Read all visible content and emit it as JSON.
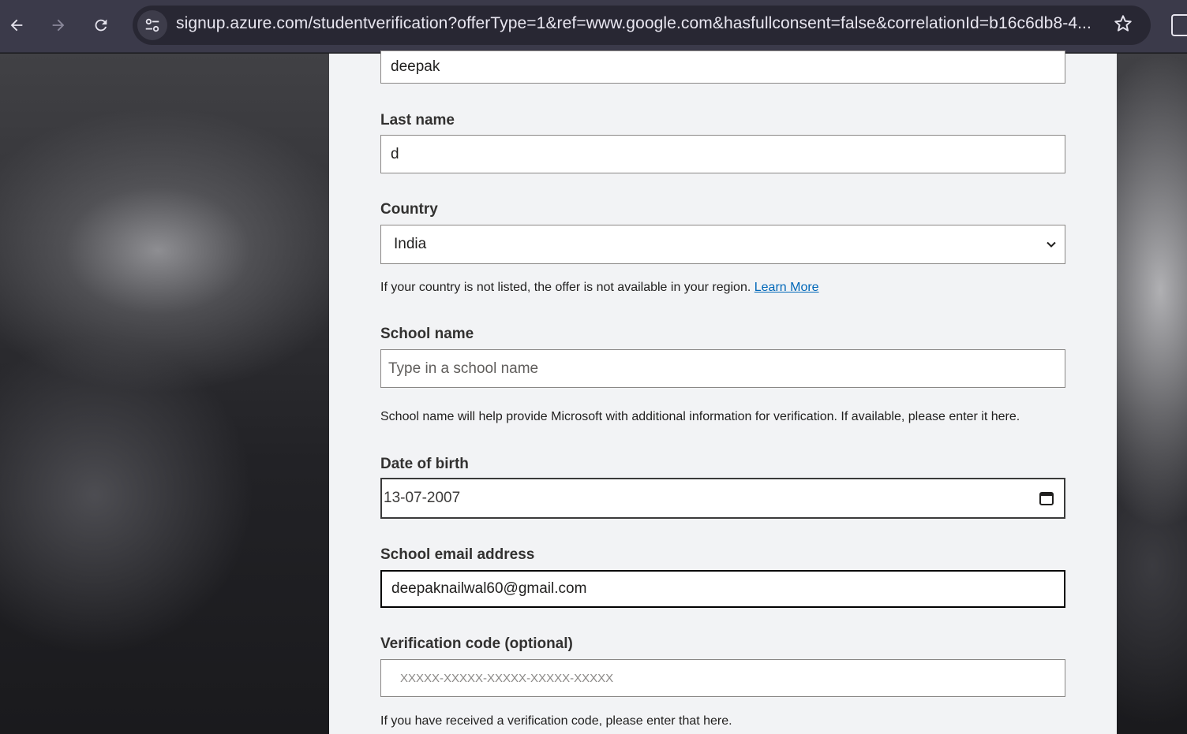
{
  "browser": {
    "url": "signup.azure.com/studentverification?offerType=1&ref=www.google.com&hasfullconsent=false&correlationId=b16c6db8-4...",
    "back_icon": "arrow-left-icon",
    "forward_icon": "arrow-right-icon",
    "reload_icon": "reload-icon",
    "site_info_icon": "tune-icon",
    "bookmark_icon": "star-icon"
  },
  "form": {
    "first_name": {
      "value": "deepak"
    },
    "last_name": {
      "label": "Last name",
      "value": "d"
    },
    "country": {
      "label": "Country",
      "selected": "India",
      "helper": "If your country is not listed, the offer is not available in your region.",
      "learn_more": "Learn More"
    },
    "school_name": {
      "label": "School name",
      "placeholder": "Type in a school name",
      "helper": "School name will help provide Microsoft with additional information for verification. If available, please enter it here."
    },
    "dob": {
      "label": "Date of birth",
      "value": "13-07-2007",
      "icon": "calendar-icon"
    },
    "school_email": {
      "label": "School email address",
      "value": "deepaknailwal60@gmail.com"
    },
    "verification_code": {
      "label": "Verification code (optional)",
      "placeholder": "XXXXX-XXXXX-XXXXX-XXXXX-XXXXX",
      "helper": "If you have received a verification code, please enter that here."
    }
  }
}
